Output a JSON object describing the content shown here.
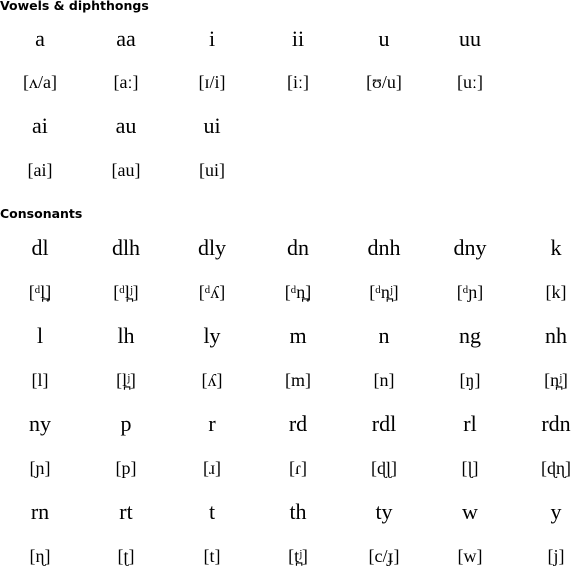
{
  "vowels": {
    "heading": "Vowels & diphthongs",
    "items": [
      {
        "letter": "a",
        "ipa": "[ʌ/a]"
      },
      {
        "letter": "aa",
        "ipa": "[aː]"
      },
      {
        "letter": "i",
        "ipa": "[ɪ/i]"
      },
      {
        "letter": "ii",
        "ipa": "[iː]"
      },
      {
        "letter": "u",
        "ipa": "[ʊ/u]"
      },
      {
        "letter": "uu",
        "ipa": "[uː]"
      },
      {
        "letter": "ai",
        "ipa": "[ai]"
      },
      {
        "letter": "au",
        "ipa": "[au]"
      },
      {
        "letter": "ui",
        "ipa": "[ui]"
      }
    ]
  },
  "consonants": {
    "heading": "Consonants",
    "items": [
      {
        "letter": "dl",
        "ipa": "[ᵈl̪]"
      },
      {
        "letter": "dlh",
        "ipa": "[ᵈl̪ʲ]"
      },
      {
        "letter": "dly",
        "ipa": "[ᵈʎ]"
      },
      {
        "letter": "dn",
        "ipa": "[ᵈn̪]"
      },
      {
        "letter": "dnh",
        "ipa": "[ᵈn̪ʲ]"
      },
      {
        "letter": "dny",
        "ipa": "[ᵈɲ]"
      },
      {
        "letter": "k",
        "ipa": "[k]"
      },
      {
        "letter": "l",
        "ipa": "[l]"
      },
      {
        "letter": "lh",
        "ipa": "[l̪ʲ]"
      },
      {
        "letter": "ly",
        "ipa": "[ʎ]"
      },
      {
        "letter": "m",
        "ipa": "[m]"
      },
      {
        "letter": "n",
        "ipa": "[n]"
      },
      {
        "letter": "ng",
        "ipa": "[ŋ]"
      },
      {
        "letter": "nh",
        "ipa": "[n̪ʲ]"
      },
      {
        "letter": "ny",
        "ipa": "[ɲ]"
      },
      {
        "letter": "p",
        "ipa": "[p]"
      },
      {
        "letter": "r",
        "ipa": "[ɹ]"
      },
      {
        "letter": "rd",
        "ipa": "[ɾ]"
      },
      {
        "letter": "rdl",
        "ipa": "[ɖɭ]"
      },
      {
        "letter": "rl",
        "ipa": "[ɭ]"
      },
      {
        "letter": "rdn",
        "ipa": "[ɖɳ]"
      },
      {
        "letter": "rn",
        "ipa": "[ɳ]"
      },
      {
        "letter": "rt",
        "ipa": "[ʈ]"
      },
      {
        "letter": "t",
        "ipa": "[t]"
      },
      {
        "letter": "th",
        "ipa": "[t̪ʲ]"
      },
      {
        "letter": "ty",
        "ipa": "[c/ɟ]"
      },
      {
        "letter": "w",
        "ipa": "[w]"
      },
      {
        "letter": "y",
        "ipa": "[j]"
      }
    ]
  }
}
